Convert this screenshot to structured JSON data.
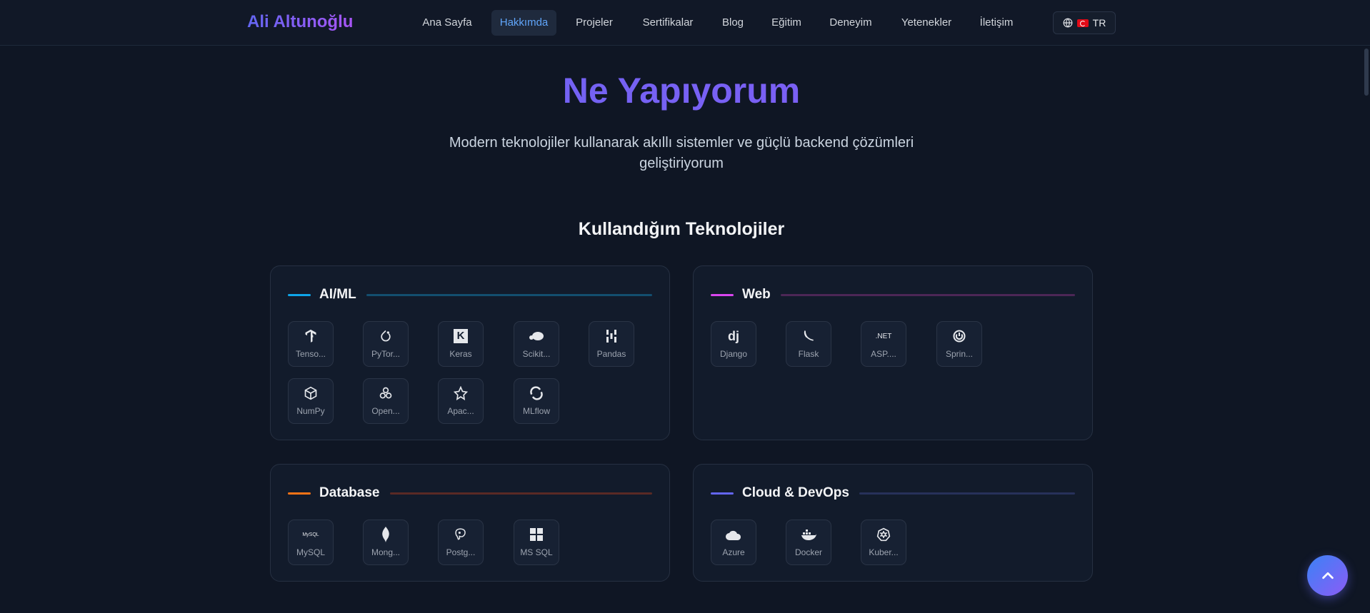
{
  "header": {
    "logo": "Ali Altunoğlu",
    "nav": [
      {
        "label": "Ana Sayfa"
      },
      {
        "label": "Hakkımda"
      },
      {
        "label": "Projeler"
      },
      {
        "label": "Sertifikalar"
      },
      {
        "label": "Blog"
      },
      {
        "label": "Eğitim"
      },
      {
        "label": "Deneyim"
      },
      {
        "label": "Yetenekler"
      },
      {
        "label": "İletişim"
      }
    ],
    "active_nav": "Hakkımda",
    "language": "TR"
  },
  "hero": {
    "title": "Ne Yapıyorum",
    "subtitle": "Modern teknolojiler kullanarak akıllı sistemler ve güçlü backend çözümleri geliştiriyorum"
  },
  "tech": {
    "title": "Kullandığım Teknolojiler",
    "categories": [
      {
        "title": "AI/ML",
        "accent": "#0ea5e9",
        "line": "#134e6f",
        "items": [
          {
            "label": "Tenso...",
            "icon": "tensorflow-icon"
          },
          {
            "label": "PyTor...",
            "icon": "pytorch-icon"
          },
          {
            "label": "Keras",
            "icon": "keras-icon"
          },
          {
            "label": "Scikit...",
            "icon": "scikit-learn-icon"
          },
          {
            "label": "Pandas",
            "icon": "pandas-icon"
          },
          {
            "label": "NumPy",
            "icon": "numpy-icon"
          },
          {
            "label": "Open...",
            "icon": "openai-icon"
          },
          {
            "label": "Apac...",
            "icon": "apache-spark-icon"
          },
          {
            "label": "MLflow",
            "icon": "mlflow-icon"
          }
        ]
      },
      {
        "title": "Web",
        "accent": "#d946ef",
        "line": "#4c2756",
        "items": [
          {
            "label": "Django",
            "icon": "django-icon"
          },
          {
            "label": "Flask",
            "icon": "flask-icon"
          },
          {
            "label": "ASP....",
            "icon": "dotnet-icon"
          },
          {
            "label": "Sprin...",
            "icon": "spring-icon"
          }
        ]
      },
      {
        "title": "Database",
        "accent": "#f97316",
        "line": "#5a2a25",
        "items": [
          {
            "label": "MySQL",
            "icon": "mysql-icon"
          },
          {
            "label": "Mong...",
            "icon": "mongodb-icon"
          },
          {
            "label": "Postg...",
            "icon": "postgresql-icon"
          },
          {
            "label": "MS SQL",
            "icon": "mssql-icon"
          }
        ]
      },
      {
        "title": "Cloud & DevOps",
        "accent": "#6366f1",
        "line": "#27315a",
        "items": [
          {
            "label": "Azure",
            "icon": "azure-icon"
          },
          {
            "label": "Docker",
            "icon": "docker-icon"
          },
          {
            "label": "Kuber...",
            "icon": "kubernetes-icon"
          }
        ]
      }
    ]
  },
  "icon_glyphs": {
    "keras": "K",
    "django": "dj",
    "dotnet": ".NET",
    "mysql": "MySQL"
  }
}
